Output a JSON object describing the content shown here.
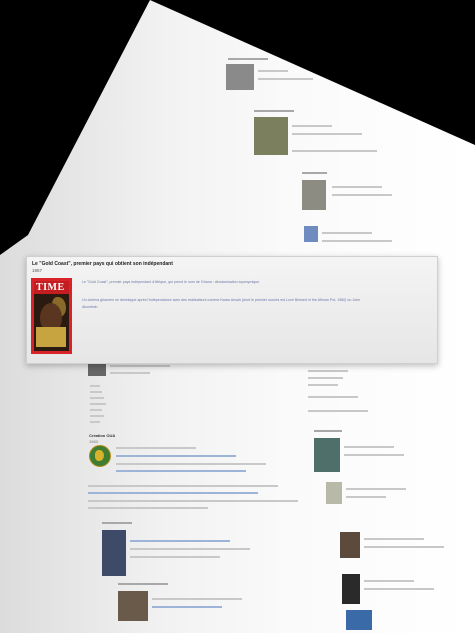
{
  "popup": {
    "title": "Le \"Gold Coast\", premier pays qui obtient son indépendant",
    "year": "1957",
    "cover_magazine": "TIME",
    "line1": "Le \"Gold Coast\", premier pays indépendant d'Afrique, qui prend le nom de Ghana : décolonisation toponymique",
    "line2": "Un cinéma ghanéen se développe après l'indépendance avec des réalisateurs comme Kwaw Ansah (dont le premier succès est Love Brewed in the African Pot, 1980) ou John",
    "line3": "Akomfrah."
  },
  "page": {
    "section_title": "Création OUA",
    "section_year": "1963"
  },
  "colors": {
    "accent_red": "#d8232a",
    "link_blue": "#6b78a8"
  }
}
